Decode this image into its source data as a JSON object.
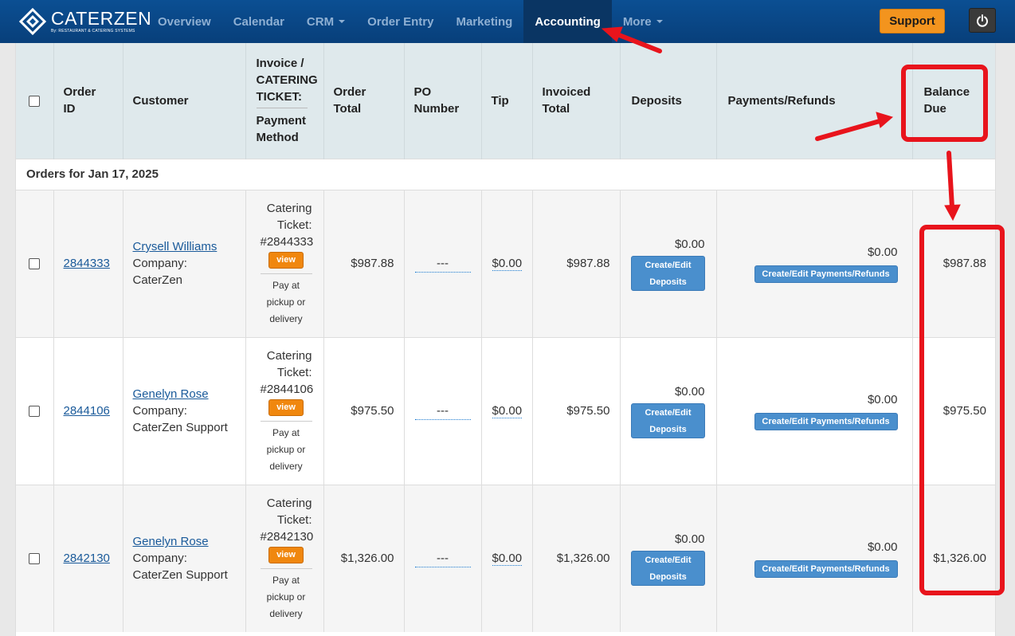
{
  "brand": {
    "name": "CATERZEN",
    "tagline": "By: RESTAURANT & CATERING SYSTEMS"
  },
  "nav": {
    "items": [
      {
        "label": "Overview",
        "dropdown": false,
        "active": false
      },
      {
        "label": "Calendar",
        "dropdown": false,
        "active": false
      },
      {
        "label": "CRM",
        "dropdown": true,
        "active": false
      },
      {
        "label": "Order Entry",
        "dropdown": false,
        "active": false
      },
      {
        "label": "Marketing",
        "dropdown": false,
        "active": false
      },
      {
        "label": "Accounting",
        "dropdown": false,
        "active": true
      },
      {
        "label": "More",
        "dropdown": true,
        "active": false
      }
    ],
    "support_label": "Support",
    "power_icon": "power-icon"
  },
  "colors": {
    "navbar": "#0b4f93",
    "support": "#f3941e",
    "header_bg": "#dfe9ec",
    "annotation": "#e8141c",
    "button_blue": "#4a8fcd",
    "view_orange": "#f0870e"
  },
  "table": {
    "headers": {
      "order_id": [
        "Order",
        "ID"
      ],
      "customer": "Customer",
      "invoice": [
        "Invoice /",
        "CATERING",
        "TICKET:"
      ],
      "payment_method": [
        "Payment",
        "Method"
      ],
      "order_total": [
        "Order",
        "Total"
      ],
      "po_number": [
        "PO",
        "Number"
      ],
      "tip": "Tip",
      "invoiced_total": [
        "Invoiced",
        "Total"
      ],
      "deposits": "Deposits",
      "payments_refunds": "Payments/Refunds",
      "balance_due": [
        "Balance",
        "Due"
      ]
    },
    "group_label": "Orders for Jan 17, 2025",
    "rows": [
      {
        "order_id": "2844333",
        "customer_name": "Crysell Williams",
        "company_label": "Company:",
        "company": "CaterZen",
        "ticket": [
          "Catering",
          "Ticket:",
          "#2844333"
        ],
        "view_label": "view",
        "payment_method": [
          "Pay at",
          "pickup or",
          "delivery"
        ],
        "order_total": "$987.88",
        "po_number": "---",
        "tip": "$0.00",
        "invoiced_total": "$987.88",
        "deposits": "$0.00",
        "deposit_button": [
          "Create/Edit",
          "Deposits"
        ],
        "payments": "$0.00",
        "payments_button": "Create/Edit Payments/Refunds",
        "balance_due": "$987.88"
      },
      {
        "order_id": "2844106",
        "customer_name": "Genelyn Rose",
        "company_label": "Company:",
        "company": "CaterZen Support",
        "ticket": [
          "Catering",
          "Ticket:",
          "#2844106"
        ],
        "view_label": "view",
        "payment_method": [
          "Pay at",
          "pickup or",
          "delivery"
        ],
        "order_total": "$975.50",
        "po_number": "---",
        "tip": "$0.00",
        "invoiced_total": "$975.50",
        "deposits": "$0.00",
        "deposit_button": [
          "Create/Edit",
          "Deposits"
        ],
        "payments": "$0.00",
        "payments_button": "Create/Edit Payments/Refunds",
        "balance_due": "$975.50"
      },
      {
        "order_id": "2842130",
        "customer_name": "Genelyn Rose",
        "company_label": "Company:",
        "company": "CaterZen Support",
        "ticket": [
          "Catering",
          "Ticket:",
          "#2842130"
        ],
        "view_label": "view",
        "payment_method": [
          "Pay at",
          "pickup or",
          "delivery"
        ],
        "order_total": "$1,326.00",
        "po_number": "---",
        "tip": "$0.00",
        "invoiced_total": "$1,326.00",
        "deposits": "$0.00",
        "deposit_button": [
          "Create/Edit",
          "Deposits"
        ],
        "payments": "$0.00",
        "payments_button": "Create/Edit Payments/Refunds",
        "balance_due": "$1,326.00"
      }
    ]
  }
}
